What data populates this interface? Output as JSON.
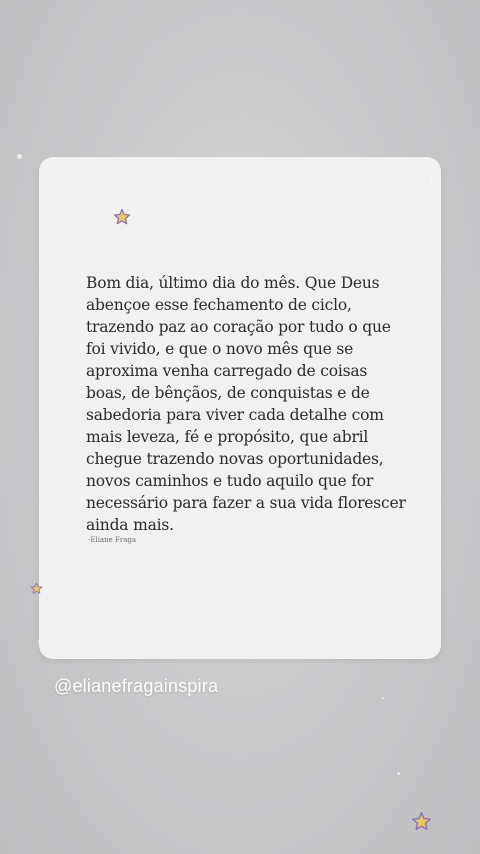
{
  "post": {
    "quote": "Bom dia, último dia do mês. Que Deus abençoe esse fechamento de ciclo, trazendo paz ao coração por tudo o que foi vivido, e que o novo mês que se aproxima venha carregado de coisas boas, de bênçãos, de conquistas e de sabedoria para viver cada detalhe com mais leveza, fé e propósito, que abril chegue trazendo novas oportunidades, novos caminhos e tudo aquilo que for necessário para fazer a sua vida florescer ainda mais.",
    "author": "-Eliane Fraga"
  },
  "profile": {
    "handle": "@elianefragainspira"
  },
  "decorations": {
    "icon": "star-icon",
    "star_color": "#e8c66a",
    "star_outline": "#8a6fb0"
  }
}
